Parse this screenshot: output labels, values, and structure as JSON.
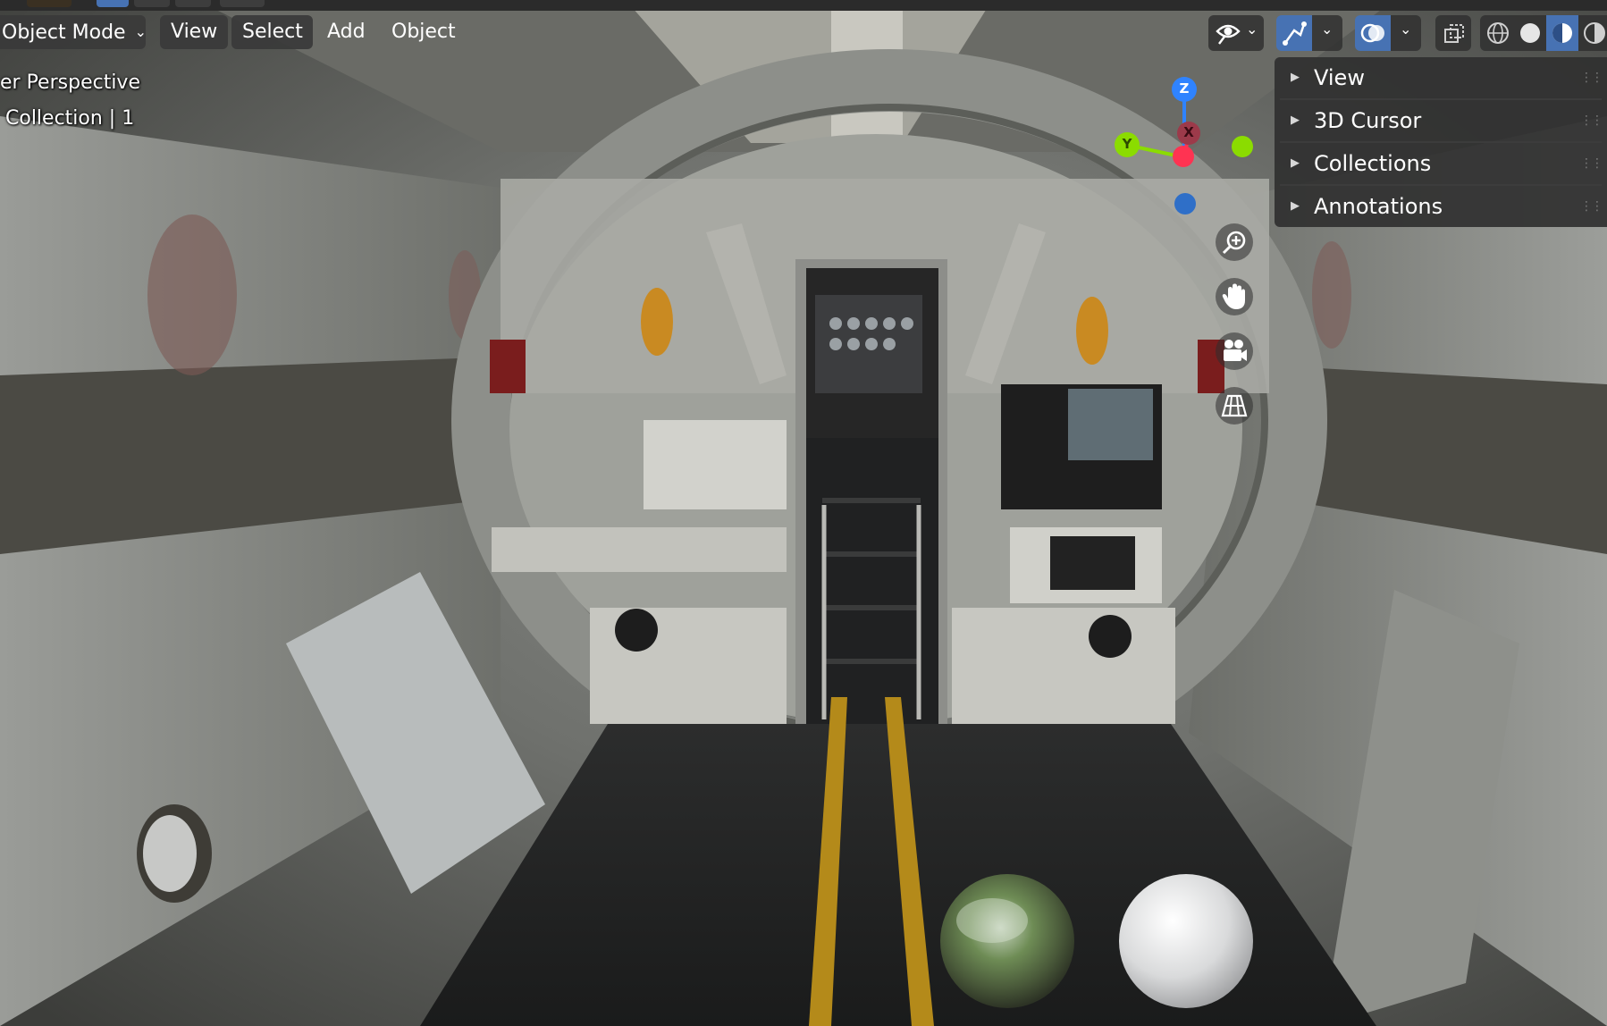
{
  "header": {
    "mode_label": "Object Mode",
    "menus": [
      {
        "label": "View"
      },
      {
        "label": "Select"
      },
      {
        "label": "Add"
      },
      {
        "label": "Object"
      }
    ]
  },
  "viewport_overlay": {
    "view_name": "er Perspective",
    "collection_info": "Collection | 1"
  },
  "sidebar_panel": {
    "items": [
      {
        "label": "View"
      },
      {
        "label": "3D Cursor"
      },
      {
        "label": "Collections"
      },
      {
        "label": "Annotations"
      }
    ]
  },
  "nav_gizmo": {
    "z_label": "Z",
    "y_label": "Y",
    "x_label": "X"
  },
  "colors": {
    "axis_x": "#ff3352",
    "axis_y": "#8bdc00",
    "axis_z": "#2f83ff",
    "active_toggle": "#4772b3",
    "header_bg": "#303030"
  },
  "icons": [
    "visibility-eye-icon",
    "gizmo-toggle-icon",
    "overlay-toggle-icon",
    "xray-toggle-icon",
    "wireframe-shading-icon",
    "solid-shading-icon",
    "material-preview-shading-icon",
    "rendered-shading-icon",
    "zoom-icon",
    "pan-hand-icon",
    "camera-view-icon",
    "ortho-grid-icon"
  ]
}
